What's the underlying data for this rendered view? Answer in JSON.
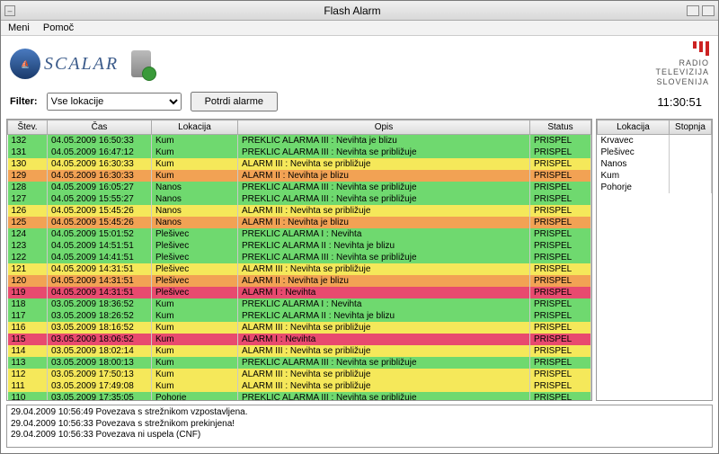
{
  "window": {
    "title": "Flash Alarm"
  },
  "menu": {
    "item1": "Meni",
    "item2": "Pomoč"
  },
  "brand": {
    "name": "SCALAR",
    "rtv_line1": "RADIO",
    "rtv_line2": "TELEVIZIJA",
    "rtv_line3": "SLOVENIJA"
  },
  "filter": {
    "label": "Filter:",
    "select_value": "Vse lokacije",
    "button": "Potrdi alarme"
  },
  "clock": "11:30:51",
  "columns": {
    "stev": "Štev.",
    "cas": "Čas",
    "lok": "Lokacija",
    "opis": "Opis",
    "status": "Status"
  },
  "rows": [
    {
      "stev": "132",
      "cas": "04.05.2009 16:50:33",
      "lok": "Kum",
      "opis": "PREKLIC ALARMA III : Nevihta je blizu",
      "status": "PRISPEL",
      "color": "green"
    },
    {
      "stev": "131",
      "cas": "04.05.2009 16:47:12",
      "lok": "Kum",
      "opis": "PREKLIC ALARMA III : Nevihta se približuje",
      "status": "PRISPEL",
      "color": "green"
    },
    {
      "stev": "130",
      "cas": "04.05.2009 16:30:33",
      "lok": "Kum",
      "opis": "ALARM III : Nevihta se približuje",
      "status": "PRISPEL",
      "color": "yellow"
    },
    {
      "stev": "129",
      "cas": "04.05.2009 16:30:33",
      "lok": "Kum",
      "opis": "ALARM II : Nevihta je blizu",
      "status": "PRISPEL",
      "color": "orange"
    },
    {
      "stev": "128",
      "cas": "04.05.2009 16:05:27",
      "lok": "Nanos",
      "opis": "PREKLIC ALARMA III : Nevihta se približuje",
      "status": "PRISPEL",
      "color": "green"
    },
    {
      "stev": "127",
      "cas": "04.05.2009 15:55:27",
      "lok": "Nanos",
      "opis": "PREKLIC ALARMA III : Nevihta se približuje",
      "status": "PRISPEL",
      "color": "green"
    },
    {
      "stev": "126",
      "cas": "04.05.2009 15:45:26",
      "lok": "Nanos",
      "opis": "ALARM III : Nevihta se približuje",
      "status": "PRISPEL",
      "color": "yellow"
    },
    {
      "stev": "125",
      "cas": "04.05.2009 15:45:26",
      "lok": "Nanos",
      "opis": "ALARM II : Nevihta je blizu",
      "status": "PRISPEL",
      "color": "orange"
    },
    {
      "stev": "124",
      "cas": "04.05.2009 15:01:52",
      "lok": "Plešivec",
      "opis": "PREKLIC ALARMA I : Nevihta",
      "status": "PRISPEL",
      "color": "green"
    },
    {
      "stev": "123",
      "cas": "04.05.2009 14:51:51",
      "lok": "Plešivec",
      "opis": "PREKLIC ALARMA II : Nevihta je blizu",
      "status": "PRISPEL",
      "color": "green"
    },
    {
      "stev": "122",
      "cas": "04.05.2009 14:41:51",
      "lok": "Plešivec",
      "opis": "PREKLIC ALARMA III : Nevihta se približuje",
      "status": "PRISPEL",
      "color": "green"
    },
    {
      "stev": "121",
      "cas": "04.05.2009 14:31:51",
      "lok": "Plešivec",
      "opis": "ALARM III : Nevihta se približuje",
      "status": "PRISPEL",
      "color": "yellow"
    },
    {
      "stev": "120",
      "cas": "04.05.2009 14:31:51",
      "lok": "Plešivec",
      "opis": "ALARM II : Nevihta je blizu",
      "status": "PRISPEL",
      "color": "orange"
    },
    {
      "stev": "119",
      "cas": "04.05.2009 14:31:51",
      "lok": "Plešivec",
      "opis": "ALARM I : Nevihta",
      "status": "PRISPEL",
      "color": "red"
    },
    {
      "stev": "118",
      "cas": "03.05.2009 18:36:52",
      "lok": "Kum",
      "opis": "PREKLIC ALARMA I : Nevihta",
      "status": "PRISPEL",
      "color": "green"
    },
    {
      "stev": "117",
      "cas": "03.05.2009 18:26:52",
      "lok": "Kum",
      "opis": "PREKLIC ALARMA II : Nevihta je blizu",
      "status": "PRISPEL",
      "color": "green"
    },
    {
      "stev": "116",
      "cas": "03.05.2009 18:16:52",
      "lok": "Kum",
      "opis": "ALARM III : Nevihta se približuje",
      "status": "PRISPEL",
      "color": "yellow"
    },
    {
      "stev": "115",
      "cas": "03.05.2009 18:06:52",
      "lok": "Kum",
      "opis": "ALARM I : Nevihta",
      "status": "PRISPEL",
      "color": "red"
    },
    {
      "stev": "114",
      "cas": "03.05.2009 18:02:14",
      "lok": "Kum",
      "opis": "ALARM III : Nevihta se približuje",
      "status": "PRISPEL",
      "color": "yellow"
    },
    {
      "stev": "113",
      "cas": "03.05.2009 18:00:13",
      "lok": "Kum",
      "opis": "PREKLIC ALARMA III : Nevihta se približuje",
      "status": "PRISPEL",
      "color": "green"
    },
    {
      "stev": "112",
      "cas": "03.05.2009 17:50:13",
      "lok": "Kum",
      "opis": "ALARM III : Nevihta se približuje",
      "status": "PRISPEL",
      "color": "yellow"
    },
    {
      "stev": "111",
      "cas": "03.05.2009 17:49:08",
      "lok": "Kum",
      "opis": "ALARM III : Nevihta se približuje",
      "status": "PRISPEL",
      "color": "yellow"
    },
    {
      "stev": "110",
      "cas": "03.05.2009 17:35:05",
      "lok": "Pohorje",
      "opis": "PREKLIC ALARMA III : Nevihta se približuje",
      "status": "PRISPEL",
      "color": "green"
    }
  ],
  "side_columns": {
    "lok": "Lokacija",
    "stp": "Stopnja"
  },
  "side_rows": [
    {
      "lok": "Krvavec",
      "stp": ""
    },
    {
      "lok": "Plešivec",
      "stp": ""
    },
    {
      "lok": "Nanos",
      "stp": ""
    },
    {
      "lok": "Kum",
      "stp": ""
    },
    {
      "lok": "Pohorje",
      "stp": ""
    }
  ],
  "log": [
    "29.04.2009 10:56:49 Povezava s strežnikom vzpostavljena.",
    "29.04.2009 10:56:33 Povezava s strežnikom prekinjena!",
    "29.04.2009 10:56:33 Povezava ni uspela (CNF)"
  ]
}
